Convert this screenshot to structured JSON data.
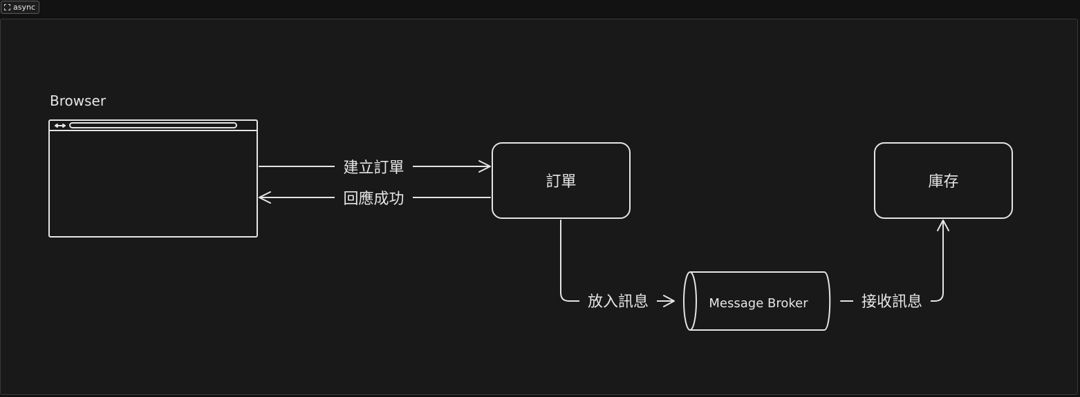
{
  "frame": {
    "label": "async",
    "icon": "frame-icon"
  },
  "browser": {
    "title": "Browser",
    "icon": "browser-window-icon"
  },
  "nodes": {
    "order": "訂單",
    "inventory": "庫存",
    "broker": "Message Broker"
  },
  "edges": {
    "create_order": "建立訂單",
    "response_success": "回應成功",
    "put_message": "放入訊息",
    "receive_message": "接收訊息"
  },
  "colors": {
    "background": "#191919",
    "stroke": "#e6e6e6"
  }
}
